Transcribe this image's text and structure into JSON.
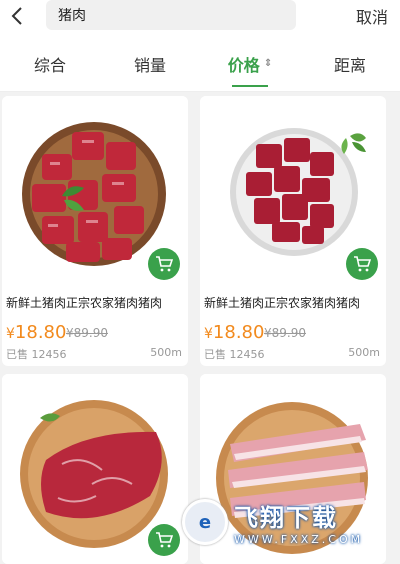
{
  "search": {
    "value": "猪肉"
  },
  "header": {
    "cancel_label": "取消"
  },
  "tabs": [
    {
      "label": "综合"
    },
    {
      "label": "销量"
    },
    {
      "label": "价格",
      "active": true
    },
    {
      "label": "距离"
    }
  ],
  "products": [
    {
      "title": "新鲜土猪肉正宗农家猪肉猪肉",
      "price_symbol": "¥",
      "price": "18.80",
      "orig_price": "¥89.90",
      "sold": "已售 12456",
      "distance": "500m"
    },
    {
      "title": "新鲜土猪肉正宗农家猪肉猪肉",
      "price_symbol": "¥",
      "price": "18.80",
      "orig_price": "¥89.90",
      "sold": "已售 12456",
      "distance": "500m"
    }
  ],
  "watermark": {
    "text": "飞翔下载",
    "url_text": "WWW.FXXZ.COM"
  },
  "colors": {
    "accent": "#3aa14b",
    "price": "#f28a1d"
  }
}
